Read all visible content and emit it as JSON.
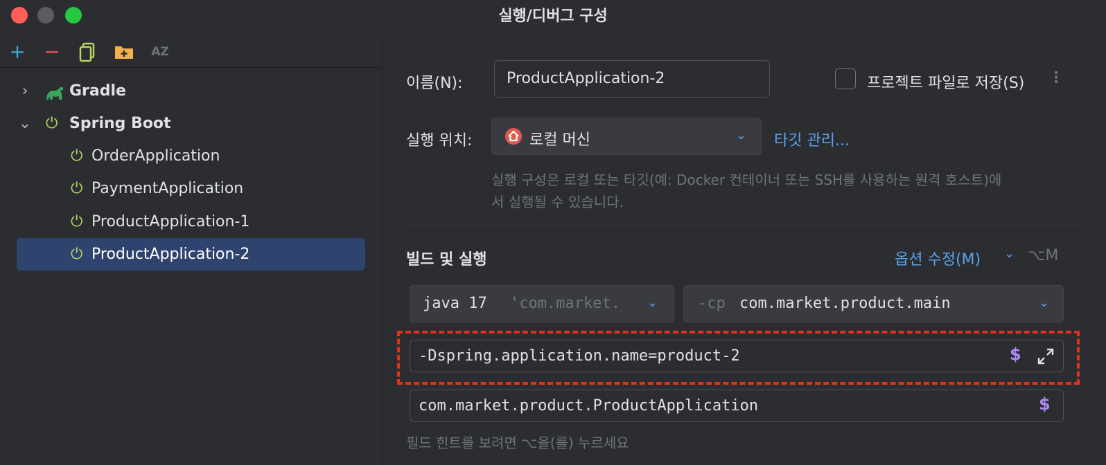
{
  "window": {
    "title": "실행/디버그 구성"
  },
  "toolbar": {
    "add": "+",
    "remove": "−",
    "sort": "AZ"
  },
  "tree": {
    "groups": [
      {
        "label": "Gradle",
        "expanded": false
      },
      {
        "label": "Spring Boot",
        "expanded": true
      }
    ],
    "items": [
      {
        "label": "OrderApplication"
      },
      {
        "label": "PaymentApplication"
      },
      {
        "label": "ProductApplication-1"
      },
      {
        "label": "ProductApplication-2",
        "selected": true
      }
    ]
  },
  "form": {
    "name_label": "이름(N):",
    "name_value": "ProductApplication-2",
    "store_as_project_file": "프로젝트 파일로 저장(S)",
    "run_on_label": "실행 위치:",
    "run_on_value": "로컬 머신",
    "manage_targets": "타깃 관리...",
    "run_on_hint_line1": "실행 구성은 로컬 또는 타깃(예: Docker 컨테이너 또는 SSH를 사용하는 원격 호스트)에",
    "run_on_hint_line2": "서 실행될 수 있습니다.",
    "build_run_title": "빌드 및 실행",
    "modify_options": "옵션 수정(M)",
    "modify_options_shortcut": "⌥M",
    "jre_value": "java 17",
    "jre_hint": "'com.market.",
    "cp_prefix": "-cp",
    "cp_value": "com.market.product.main",
    "vm_options": "-Dspring.application.name=product-2",
    "main_class": "com.market.product.ProductApplication",
    "dollar": "$",
    "field_hint": "필드 힌트를 보려면 ⌥을(를) 누르세요"
  },
  "colors": {
    "accent": "#5aa2f0",
    "selection": "#2e436e",
    "highlight_dash": "#e3321c",
    "spring_icon": "#b7d560",
    "macro_icon": "#b189f5"
  }
}
